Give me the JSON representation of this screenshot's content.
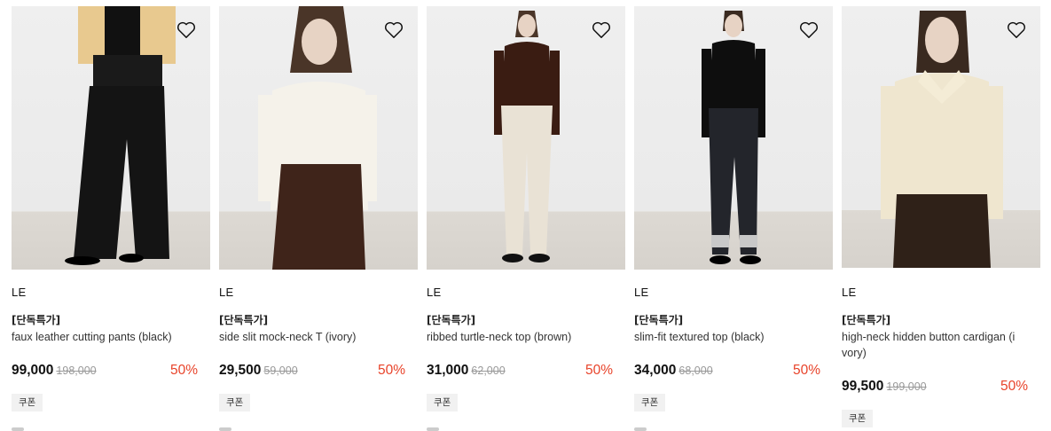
{
  "products": [
    {
      "brand": "LE",
      "tag": "[단독특가]",
      "name": "faux leather cutting pants (black)",
      "price": "99,000",
      "original_price": "198,000",
      "discount": "50%",
      "coupon": "쿠폰",
      "wishlist_icon": "heart-outline-icon"
    },
    {
      "brand": "LE",
      "tag": "[단독특가]",
      "name": "side slit mock-neck T (ivory)",
      "price": "29,500",
      "original_price": "59,000",
      "discount": "50%",
      "coupon": "쿠폰",
      "wishlist_icon": "heart-outline-icon"
    },
    {
      "brand": "LE",
      "tag": "[단독특가]",
      "name": "ribbed turtle-neck top (brown)",
      "price": "31,000",
      "original_price": "62,000",
      "discount": "50%",
      "coupon": "쿠폰",
      "wishlist_icon": "heart-outline-icon"
    },
    {
      "brand": "LE",
      "tag": "[단독특가]",
      "name": "slim-fit textured top (black)",
      "price": "34,000",
      "original_price": "68,000",
      "discount": "50%",
      "coupon": "쿠폰",
      "wishlist_icon": "heart-outline-icon"
    },
    {
      "brand": "LE",
      "tag": "[단독특가]",
      "name": "high-neck hidden button cardigan (i vory)",
      "price": "99,500",
      "original_price": "199,000",
      "discount": "50%",
      "coupon": "쿠폰",
      "wishlist_icon": "heart-outline-icon"
    }
  ],
  "colors": {
    "discount": "#e8432a",
    "original_price": "#999999",
    "coupon_bg": "#f1f1f1"
  }
}
